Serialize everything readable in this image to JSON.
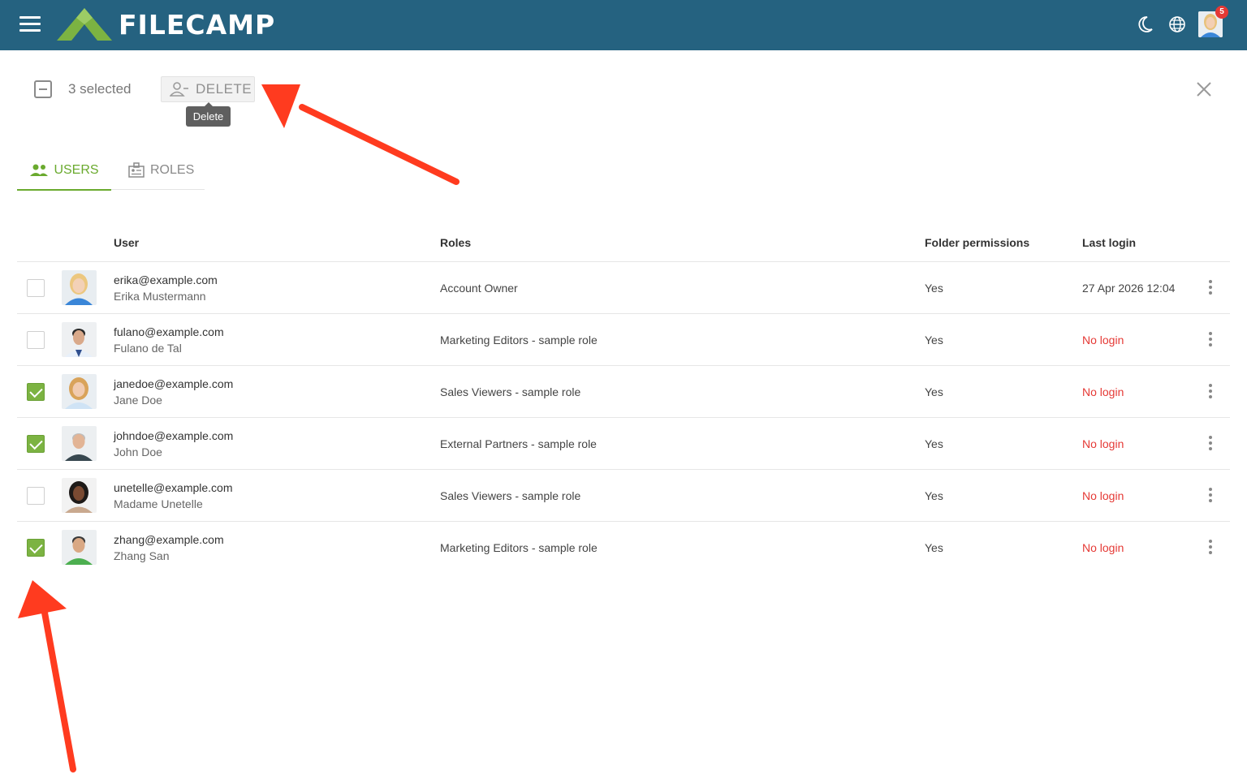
{
  "app": {
    "logo_text": "FILECAMP",
    "notification_count": "5"
  },
  "toolbar": {
    "selected_text": "3 selected",
    "delete_label": "DELETE",
    "tooltip": "Delete"
  },
  "tabs": [
    {
      "label": "USERS",
      "active": true
    },
    {
      "label": "ROLES",
      "active": false
    }
  ],
  "table": {
    "headers": {
      "user": "User",
      "roles": "Roles",
      "folder_permissions": "Folder permissions",
      "last_login": "Last login"
    },
    "rows": [
      {
        "email": "erika@example.com",
        "name": "Erika Mustermann",
        "role": "Account Owner",
        "folder_permissions": "Yes",
        "last_login": "27 Apr 2026 12:04",
        "checked": false,
        "no_login": false
      },
      {
        "email": "fulano@example.com",
        "name": "Fulano de Tal",
        "role": "Marketing Editors - sample role",
        "folder_permissions": "Yes",
        "last_login": "No login",
        "checked": false,
        "no_login": true
      },
      {
        "email": "janedoe@example.com",
        "name": "Jane Doe",
        "role": "Sales Viewers - sample role",
        "folder_permissions": "Yes",
        "last_login": "No login",
        "checked": true,
        "no_login": true
      },
      {
        "email": "johndoe@example.com",
        "name": "John Doe",
        "role": "External Partners - sample role",
        "folder_permissions": "Yes",
        "last_login": "No login",
        "checked": true,
        "no_login": true
      },
      {
        "email": "unetelle@example.com",
        "name": "Madame Unetelle",
        "role": "Sales Viewers - sample role",
        "folder_permissions": "Yes",
        "last_login": "No login",
        "checked": false,
        "no_login": true
      },
      {
        "email": "zhang@example.com",
        "name": "Zhang San",
        "role": "Marketing Editors - sample role",
        "folder_permissions": "Yes",
        "last_login": "No login",
        "checked": true,
        "no_login": true
      }
    ]
  },
  "colors": {
    "header_bg": "#256280",
    "accent_green": "#6aaa2e",
    "no_login_red": "#e53935",
    "annotation_arrow": "#ff3b1f"
  },
  "icons": [
    "menu-icon",
    "filecamp-logo",
    "moon-icon",
    "globe-icon",
    "user-avatar",
    "remove-user-icon",
    "close-icon",
    "users-icon",
    "roles-icon",
    "more-vert-icon"
  ]
}
